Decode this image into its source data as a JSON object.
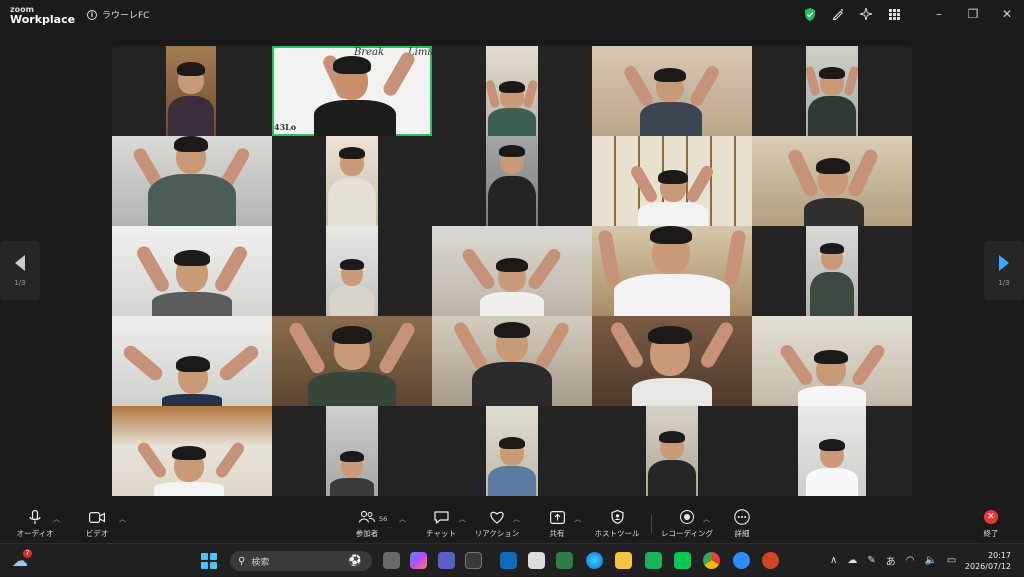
{
  "app": {
    "brand_top": "zoom",
    "brand_bottom": "Workplace",
    "meeting_title": "ラウーレFC"
  },
  "titlebar": {
    "icons": [
      "shield-check-icon",
      "pen-icon",
      "sparkle-icon",
      "grid-icon"
    ],
    "window_controls": [
      "minimize-icon",
      "restore-icon",
      "close-icon"
    ]
  },
  "gallery": {
    "page_left": "1/3",
    "page_right": "1/3",
    "banner_text_1": "Break",
    "banner_text_2": "Limit",
    "banner_text_3": "43Lo"
  },
  "toolbar": {
    "audio": "オーディオ",
    "video": "ビデオ",
    "participants": "参加者",
    "participants_count": "56",
    "chat": "チャット",
    "reactions": "リアクション",
    "share": "共有",
    "host_tools": "ホストツール",
    "recording": "レコーディング",
    "more": "詳細",
    "end": "終了"
  },
  "taskbar": {
    "search_placeholder": "検索",
    "notification_count": "7",
    "ime": "あ",
    "time": "20:17",
    "date": "2026/07/12"
  },
  "colors": {
    "active_speaker": "#27c05a",
    "end_red": "#e5383b",
    "accent_blue": "#4cc2ff"
  }
}
